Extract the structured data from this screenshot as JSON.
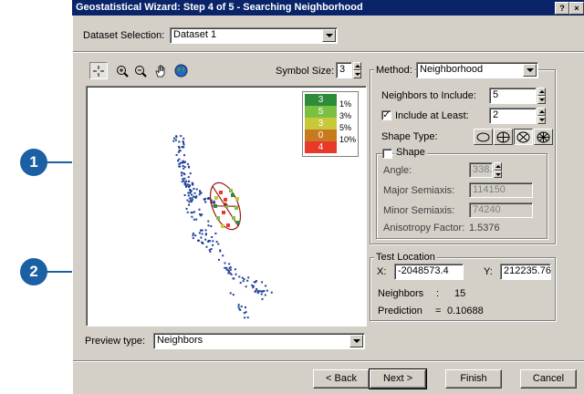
{
  "window": {
    "title": "Geostatistical Wizard: Step 4 of 5 - Searching Neighborhood",
    "help_button": "?",
    "close_button": "×"
  },
  "callouts": [
    "1",
    "2"
  ],
  "dataset": {
    "label": "Dataset Selection:",
    "value": "Dataset 1"
  },
  "toolbar": {
    "symbol_size_label": "Symbol Size:",
    "symbol_size_value": "3"
  },
  "legend": {
    "rows": [
      {
        "count": "3",
        "color": "#2e8b3a",
        "pct": "1%"
      },
      {
        "count": "5",
        "color": "#7ac143",
        "pct": "3%"
      },
      {
        "count": "3",
        "color": "#c8c83a",
        "pct": "5%"
      },
      {
        "count": "0",
        "color": "#c87a1e",
        "pct": "10%"
      },
      {
        "count": "4",
        "color": "#e8392a",
        "pct": ""
      }
    ]
  },
  "method": {
    "label": "Method:",
    "value": "Neighborhood"
  },
  "neighbors": {
    "include_label": "Neighbors to Include:",
    "include_value": "5",
    "at_least_label": "Include at Least:",
    "at_least_checked": true,
    "at_least_value": "2",
    "shape_type_label": "Shape Type:"
  },
  "shape": {
    "label": "Shape",
    "checked": false,
    "angle_label": "Angle:",
    "angle_value": "338.1",
    "major_label": "Major Semiaxis:",
    "major_value": "114150",
    "minor_label": "Minor Semiaxis:",
    "minor_value": "74240",
    "anisotropy_label": "Anisotropy Factor:",
    "anisotropy_value": "1.5376"
  },
  "test_location": {
    "title": "Test Location",
    "x_label": "X:",
    "x_value": "-2048573.4",
    "y_label": "Y:",
    "y_value": "212235.76",
    "neighbors_label": "Neighbors",
    "neighbors_sep": ":",
    "neighbors_value": "15",
    "prediction_label": "Prediction",
    "prediction_sep": "=",
    "prediction_value": "0.10688"
  },
  "preview_type": {
    "label": "Preview type:",
    "value": "Neighbors"
  },
  "buttons": {
    "back": "< Back",
    "next": "Next >",
    "finish": "Finish",
    "cancel": "Cancel"
  }
}
